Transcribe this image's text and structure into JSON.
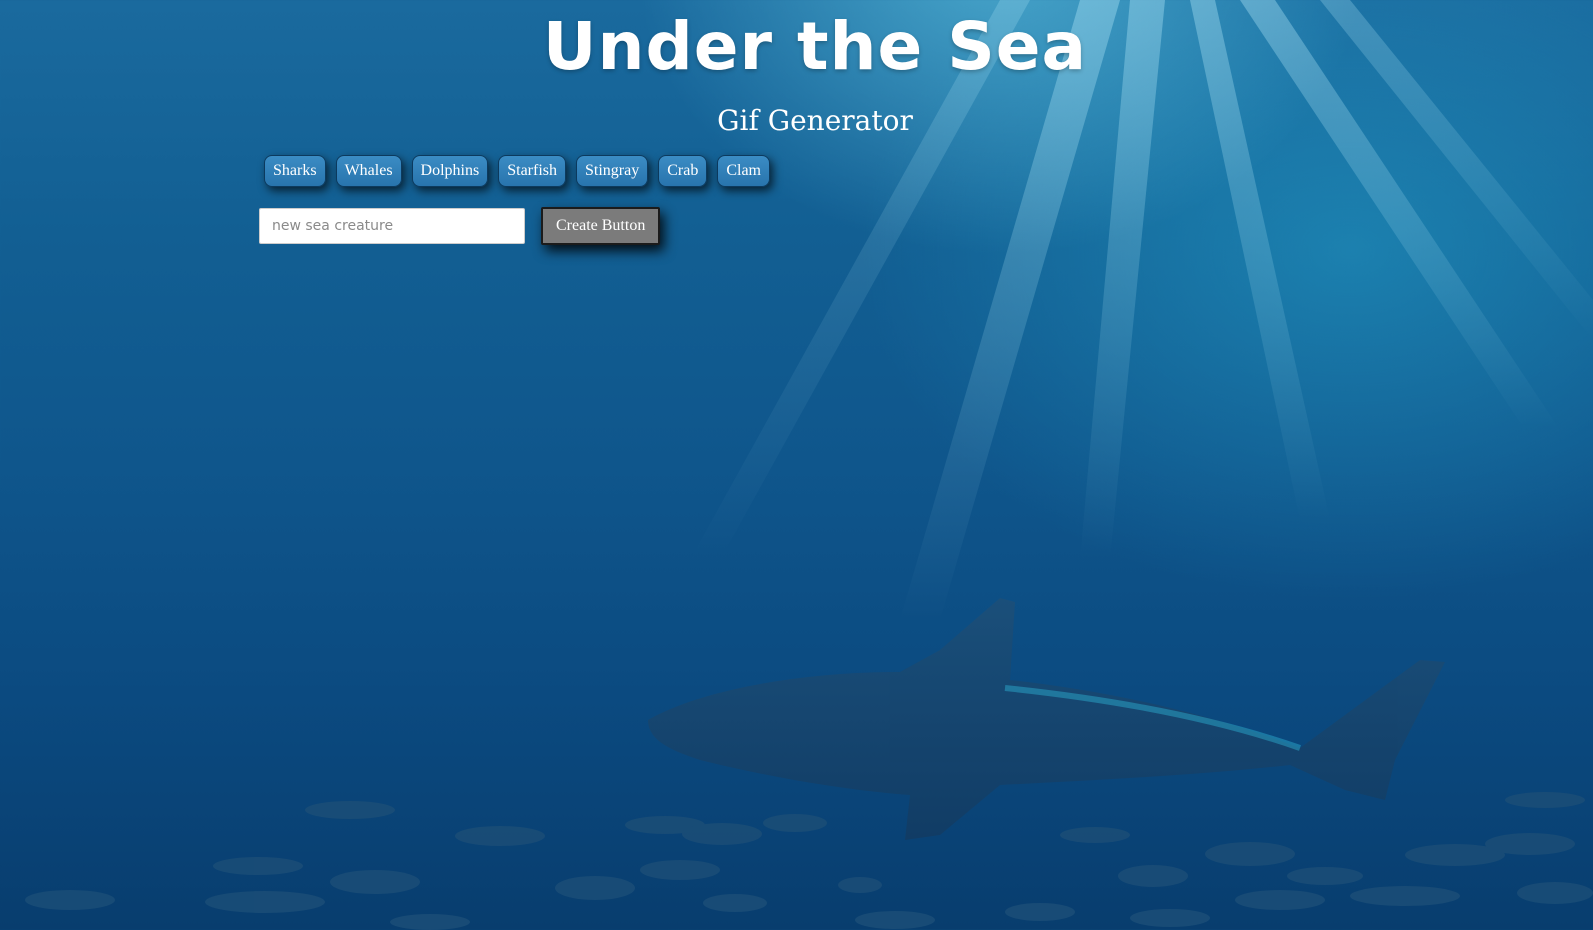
{
  "header": {
    "title": "Under the Sea",
    "subtitle": "Gif Generator"
  },
  "creature_buttons": [
    {
      "label": "Sharks"
    },
    {
      "label": "Whales"
    },
    {
      "label": "Dolphins"
    },
    {
      "label": "Starfish"
    },
    {
      "label": "Stingray"
    },
    {
      "label": "Crab"
    },
    {
      "label": "Clam"
    }
  ],
  "form": {
    "input_value": "",
    "input_placeholder": "new sea creature",
    "create_label": "Create Button"
  },
  "colors": {
    "button_blue": "#2f7fb8",
    "create_button_gray": "#7b7b7b",
    "water_deep": "#0b4a80"
  }
}
